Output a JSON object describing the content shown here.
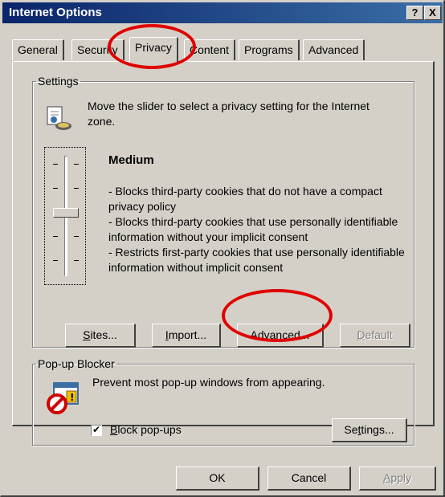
{
  "window": {
    "title": "Internet Options",
    "help_label": "?",
    "close_label": "X"
  },
  "tabs": [
    {
      "label": "General"
    },
    {
      "label": "Security"
    },
    {
      "label": "Privacy",
      "active": true
    },
    {
      "label": "Content"
    },
    {
      "label": "Programs"
    },
    {
      "label": "Advanced"
    }
  ],
  "settings": {
    "legend": "Settings",
    "icon": "privacy-icon",
    "intro": "Move the slider to select a privacy setting for the Internet zone.",
    "level": "Medium",
    "slider_position": 0.5,
    "description_lines": [
      "- Blocks third-party cookies that do not have a compact privacy policy",
      "- Blocks third-party cookies that use personally identifiable information without your implicit consent",
      "- Restricts first-party cookies that use personally identifiable information without implicit consent"
    ],
    "buttons": {
      "sites": "Sites...",
      "import": "Import...",
      "advanced": "Advanced...",
      "default": "Default"
    }
  },
  "popup": {
    "legend": "Pop-up Blocker",
    "icon": "popup-blocker-icon",
    "text": "Prevent most pop-up windows from appearing.",
    "checkbox_label": "Block pop-ups",
    "checked": true,
    "settings_button": "Settings..."
  },
  "footer": {
    "ok": "OK",
    "cancel": "Cancel",
    "apply": "Apply"
  },
  "colors": {
    "dialog_bg": "#d4d0c8",
    "title_bar": "#0a246a",
    "annotation": "#e00000"
  }
}
